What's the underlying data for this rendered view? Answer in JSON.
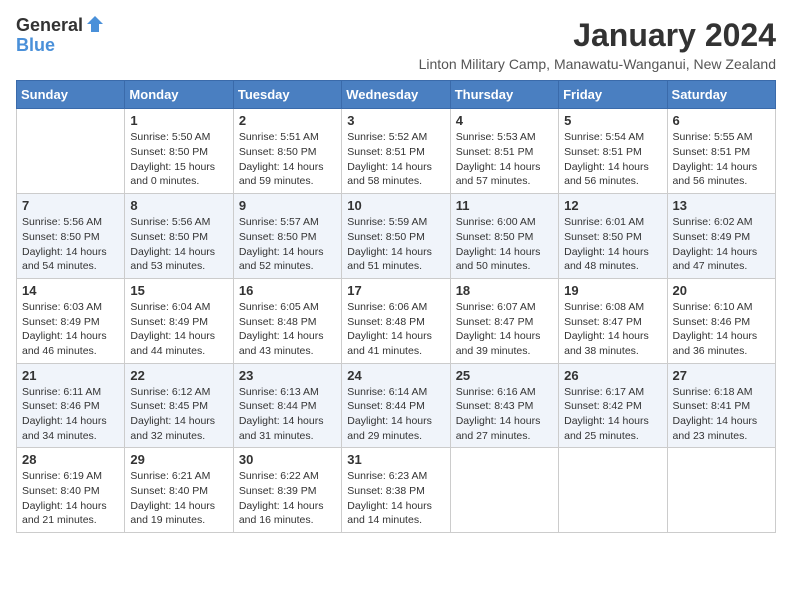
{
  "logo": {
    "general": "General",
    "blue": "Blue"
  },
  "header": {
    "month_year": "January 2024",
    "subtitle": "Linton Military Camp, Manawatu-Wanganui, New Zealand"
  },
  "days_of_week": [
    "Sunday",
    "Monday",
    "Tuesday",
    "Wednesday",
    "Thursday",
    "Friday",
    "Saturday"
  ],
  "weeks": [
    [
      {
        "day": "",
        "sunrise": "",
        "sunset": "",
        "daylight": ""
      },
      {
        "day": "1",
        "sunrise": "Sunrise: 5:50 AM",
        "sunset": "Sunset: 8:50 PM",
        "daylight": "Daylight: 15 hours and 0 minutes."
      },
      {
        "day": "2",
        "sunrise": "Sunrise: 5:51 AM",
        "sunset": "Sunset: 8:50 PM",
        "daylight": "Daylight: 14 hours and 59 minutes."
      },
      {
        "day": "3",
        "sunrise": "Sunrise: 5:52 AM",
        "sunset": "Sunset: 8:51 PM",
        "daylight": "Daylight: 14 hours and 58 minutes."
      },
      {
        "day": "4",
        "sunrise": "Sunrise: 5:53 AM",
        "sunset": "Sunset: 8:51 PM",
        "daylight": "Daylight: 14 hours and 57 minutes."
      },
      {
        "day": "5",
        "sunrise": "Sunrise: 5:54 AM",
        "sunset": "Sunset: 8:51 PM",
        "daylight": "Daylight: 14 hours and 56 minutes."
      },
      {
        "day": "6",
        "sunrise": "Sunrise: 5:55 AM",
        "sunset": "Sunset: 8:51 PM",
        "daylight": "Daylight: 14 hours and 56 minutes."
      }
    ],
    [
      {
        "day": "7",
        "sunrise": "Sunrise: 5:56 AM",
        "sunset": "Sunset: 8:50 PM",
        "daylight": "Daylight: 14 hours and 54 minutes."
      },
      {
        "day": "8",
        "sunrise": "Sunrise: 5:56 AM",
        "sunset": "Sunset: 8:50 PM",
        "daylight": "Daylight: 14 hours and 53 minutes."
      },
      {
        "day": "9",
        "sunrise": "Sunrise: 5:57 AM",
        "sunset": "Sunset: 8:50 PM",
        "daylight": "Daylight: 14 hours and 52 minutes."
      },
      {
        "day": "10",
        "sunrise": "Sunrise: 5:59 AM",
        "sunset": "Sunset: 8:50 PM",
        "daylight": "Daylight: 14 hours and 51 minutes."
      },
      {
        "day": "11",
        "sunrise": "Sunrise: 6:00 AM",
        "sunset": "Sunset: 8:50 PM",
        "daylight": "Daylight: 14 hours and 50 minutes."
      },
      {
        "day": "12",
        "sunrise": "Sunrise: 6:01 AM",
        "sunset": "Sunset: 8:50 PM",
        "daylight": "Daylight: 14 hours and 48 minutes."
      },
      {
        "day": "13",
        "sunrise": "Sunrise: 6:02 AM",
        "sunset": "Sunset: 8:49 PM",
        "daylight": "Daylight: 14 hours and 47 minutes."
      }
    ],
    [
      {
        "day": "14",
        "sunrise": "Sunrise: 6:03 AM",
        "sunset": "Sunset: 8:49 PM",
        "daylight": "Daylight: 14 hours and 46 minutes."
      },
      {
        "day": "15",
        "sunrise": "Sunrise: 6:04 AM",
        "sunset": "Sunset: 8:49 PM",
        "daylight": "Daylight: 14 hours and 44 minutes."
      },
      {
        "day": "16",
        "sunrise": "Sunrise: 6:05 AM",
        "sunset": "Sunset: 8:48 PM",
        "daylight": "Daylight: 14 hours and 43 minutes."
      },
      {
        "day": "17",
        "sunrise": "Sunrise: 6:06 AM",
        "sunset": "Sunset: 8:48 PM",
        "daylight": "Daylight: 14 hours and 41 minutes."
      },
      {
        "day": "18",
        "sunrise": "Sunrise: 6:07 AM",
        "sunset": "Sunset: 8:47 PM",
        "daylight": "Daylight: 14 hours and 39 minutes."
      },
      {
        "day": "19",
        "sunrise": "Sunrise: 6:08 AM",
        "sunset": "Sunset: 8:47 PM",
        "daylight": "Daylight: 14 hours and 38 minutes."
      },
      {
        "day": "20",
        "sunrise": "Sunrise: 6:10 AM",
        "sunset": "Sunset: 8:46 PM",
        "daylight": "Daylight: 14 hours and 36 minutes."
      }
    ],
    [
      {
        "day": "21",
        "sunrise": "Sunrise: 6:11 AM",
        "sunset": "Sunset: 8:46 PM",
        "daylight": "Daylight: 14 hours and 34 minutes."
      },
      {
        "day": "22",
        "sunrise": "Sunrise: 6:12 AM",
        "sunset": "Sunset: 8:45 PM",
        "daylight": "Daylight: 14 hours and 32 minutes."
      },
      {
        "day": "23",
        "sunrise": "Sunrise: 6:13 AM",
        "sunset": "Sunset: 8:44 PM",
        "daylight": "Daylight: 14 hours and 31 minutes."
      },
      {
        "day": "24",
        "sunrise": "Sunrise: 6:14 AM",
        "sunset": "Sunset: 8:44 PM",
        "daylight": "Daylight: 14 hours and 29 minutes."
      },
      {
        "day": "25",
        "sunrise": "Sunrise: 6:16 AM",
        "sunset": "Sunset: 8:43 PM",
        "daylight": "Daylight: 14 hours and 27 minutes."
      },
      {
        "day": "26",
        "sunrise": "Sunrise: 6:17 AM",
        "sunset": "Sunset: 8:42 PM",
        "daylight": "Daylight: 14 hours and 25 minutes."
      },
      {
        "day": "27",
        "sunrise": "Sunrise: 6:18 AM",
        "sunset": "Sunset: 8:41 PM",
        "daylight": "Daylight: 14 hours and 23 minutes."
      }
    ],
    [
      {
        "day": "28",
        "sunrise": "Sunrise: 6:19 AM",
        "sunset": "Sunset: 8:40 PM",
        "daylight": "Daylight: 14 hours and 21 minutes."
      },
      {
        "day": "29",
        "sunrise": "Sunrise: 6:21 AM",
        "sunset": "Sunset: 8:40 PM",
        "daylight": "Daylight: 14 hours and 19 minutes."
      },
      {
        "day": "30",
        "sunrise": "Sunrise: 6:22 AM",
        "sunset": "Sunset: 8:39 PM",
        "daylight": "Daylight: 14 hours and 16 minutes."
      },
      {
        "day": "31",
        "sunrise": "Sunrise: 6:23 AM",
        "sunset": "Sunset: 8:38 PM",
        "daylight": "Daylight: 14 hours and 14 minutes."
      },
      {
        "day": "",
        "sunrise": "",
        "sunset": "",
        "daylight": ""
      },
      {
        "day": "",
        "sunrise": "",
        "sunset": "",
        "daylight": ""
      },
      {
        "day": "",
        "sunrise": "",
        "sunset": "",
        "daylight": ""
      }
    ]
  ]
}
